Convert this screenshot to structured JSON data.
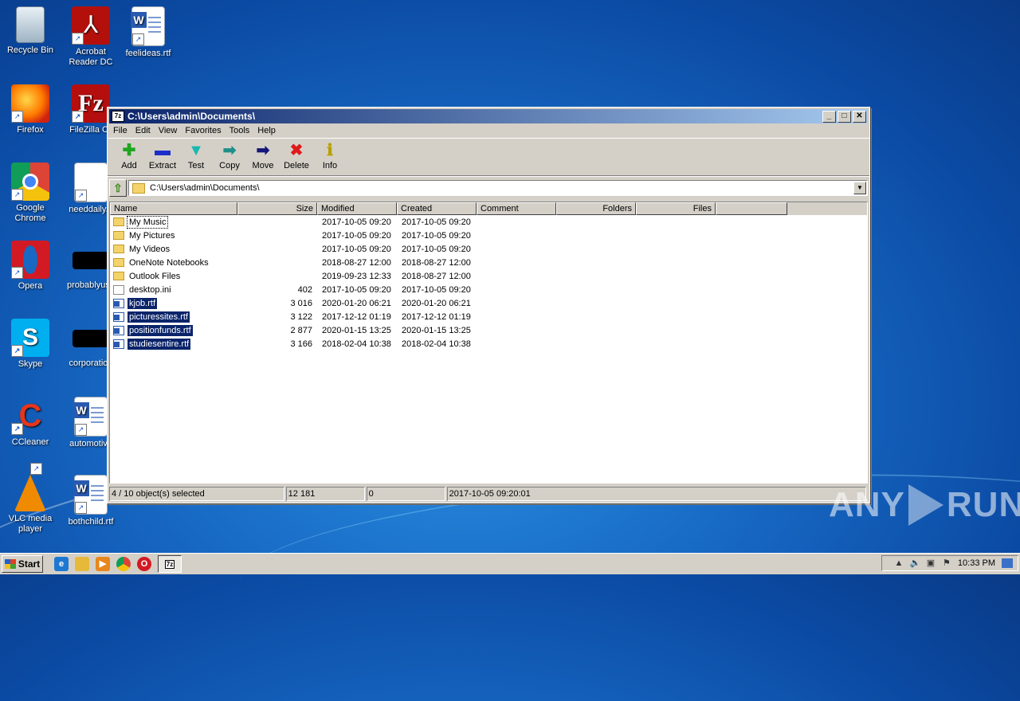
{
  "desktop": {
    "icons": [
      {
        "label": "Recycle Bin",
        "icon": "recycle-bin-icon"
      },
      {
        "label": "Acrobat Reader DC",
        "icon": "acrobat-icon"
      },
      {
        "label": "feelideas.rtf",
        "icon": "word-document-icon"
      },
      {
        "label": "Firefox",
        "icon": "firefox-icon"
      },
      {
        "label": "FileZilla Cli",
        "icon": "filezilla-icon"
      },
      {
        "label": "Google Chrome",
        "icon": "chrome-icon"
      },
      {
        "label": "needdaily.p",
        "icon": "document-icon"
      },
      {
        "label": "Opera",
        "icon": "opera-icon"
      },
      {
        "label": "probablyuse",
        "icon": "black-thumbnail"
      },
      {
        "label": "Skype",
        "icon": "skype-icon"
      },
      {
        "label": "corporation",
        "icon": "black-thumbnail"
      },
      {
        "label": "CCleaner",
        "icon": "ccleaner-icon"
      },
      {
        "label": "automotive",
        "icon": "word-document-icon"
      },
      {
        "label": "VLC media player",
        "icon": "vlc-icon"
      },
      {
        "label": "bothchild.rtf",
        "icon": "word-document-icon"
      }
    ]
  },
  "window": {
    "title": "C:\\Users\\admin\\Documents\\",
    "app_badge": "7z",
    "menu": [
      "File",
      "Edit",
      "View",
      "Favorites",
      "Tools",
      "Help"
    ],
    "toolbar": [
      {
        "label": "Add",
        "glyph": "✚",
        "color": "#1fa51f"
      },
      {
        "label": "Extract",
        "glyph": "▬",
        "color": "#1b2fc8"
      },
      {
        "label": "Test",
        "glyph": "▼",
        "color": "#19b8b0"
      },
      {
        "label": "Copy",
        "glyph": "➡",
        "color": "#1e8f8a"
      },
      {
        "label": "Move",
        "glyph": "➡",
        "color": "#14147a"
      },
      {
        "label": "Delete",
        "glyph": "✖",
        "color": "#e01a1a"
      },
      {
        "label": "Info",
        "glyph": "ℹ",
        "color": "#b8a000"
      }
    ],
    "address": "C:\\Users\\admin\\Documents\\",
    "columns": [
      "Name",
      "Size",
      "Modified",
      "Created",
      "Comment",
      "Folders",
      "Files"
    ],
    "rows": [
      {
        "name": "My Music",
        "size": "",
        "modified": "2017-10-05 09:20",
        "created": "2017-10-05 09:20",
        "type": "folder",
        "selected": false,
        "focus": true
      },
      {
        "name": "My Pictures",
        "size": "",
        "modified": "2017-10-05 09:20",
        "created": "2017-10-05 09:20",
        "type": "folder",
        "selected": false
      },
      {
        "name": "My Videos",
        "size": "",
        "modified": "2017-10-05 09:20",
        "created": "2017-10-05 09:20",
        "type": "folder",
        "selected": false
      },
      {
        "name": "OneNote Notebooks",
        "size": "",
        "modified": "2018-08-27 12:00",
        "created": "2018-08-27 12:00",
        "type": "folder",
        "selected": false
      },
      {
        "name": "Outlook Files",
        "size": "",
        "modified": "2019-09-23 12:33",
        "created": "2018-08-27 12:00",
        "type": "folder",
        "selected": false
      },
      {
        "name": "desktop.ini",
        "size": "402",
        "modified": "2017-10-05 09:20",
        "created": "2017-10-05 09:20",
        "type": "ini",
        "selected": false
      },
      {
        "name": "kjob.rtf",
        "size": "3 016",
        "modified": "2020-01-20 06:21",
        "created": "2020-01-20 06:21",
        "type": "rtf",
        "selected": true
      },
      {
        "name": "picturessites.rtf",
        "size": "3 122",
        "modified": "2017-12-12 01:19",
        "created": "2017-12-12 01:19",
        "type": "rtf",
        "selected": true
      },
      {
        "name": "positionfunds.rtf",
        "size": "2 877",
        "modified": "2020-01-15 13:25",
        "created": "2020-01-15 13:25",
        "type": "rtf",
        "selected": true
      },
      {
        "name": "studiesentire.rtf",
        "size": "3 166",
        "modified": "2018-02-04 10:38",
        "created": "2018-02-04 10:38",
        "type": "rtf",
        "selected": true
      }
    ],
    "status": {
      "selection": "4 / 10 object(s) selected",
      "total_size": "12 181",
      "packed": "0",
      "date": "2017-10-05 09:20:01"
    }
  },
  "taskbar": {
    "start_label": "Start",
    "clock": "10:33 PM"
  },
  "watermark": {
    "left": "ANY",
    "right": "RUN"
  }
}
